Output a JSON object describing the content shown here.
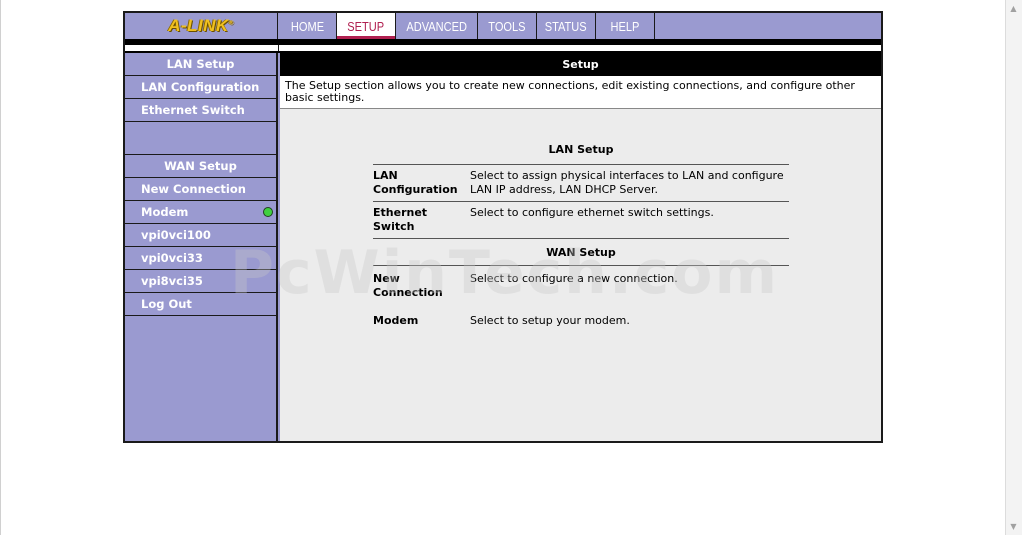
{
  "brand": {
    "logo": "A-LINK",
    "mark": "®"
  },
  "nav": {
    "tabs": [
      {
        "label": "HOME",
        "width": 58
      },
      {
        "label": "SETUP",
        "width": 59,
        "active": true
      },
      {
        "label": "ADVANCED",
        "width": 82
      },
      {
        "label": "TOOLS",
        "width": 59
      },
      {
        "label": "STATUS",
        "width": 59
      },
      {
        "label": "HELP",
        "width": 59
      }
    ]
  },
  "sidebar": {
    "lan_header": "LAN Setup",
    "lan_items": [
      "LAN Configuration",
      "Ethernet Switch"
    ],
    "wan_header": "WAN Setup",
    "wan_items": [
      "New Connection",
      "Modem",
      "vpi0vci100",
      "vpi0vci33",
      "vpi8vci35",
      "Log Out"
    ]
  },
  "content": {
    "title": "Setup",
    "intro": "The Setup section allows you to create new connections, edit existing connections, and configure other basic settings.",
    "lan_section": "LAN Setup",
    "lan_rows": [
      {
        "key": "LAN Configuration",
        "desc": "Select to assign physical interfaces to LAN and configure LAN IP address, LAN DHCP Server."
      },
      {
        "key": "Ethernet Switch",
        "desc": "Select to configure ethernet switch settings."
      }
    ],
    "wan_section": "WAN Setup",
    "wan_rows": [
      {
        "key": "New Connection",
        "desc": "Select to configure a new connection."
      },
      {
        "key": "Modem",
        "desc": "Select to setup your modem."
      }
    ]
  },
  "watermark": "PcWinTech.com",
  "colors": {
    "nav_bg": "#9a9ad0",
    "active_tab": "#b02050",
    "logo": "#f0c020",
    "status_led": "#40d040"
  }
}
